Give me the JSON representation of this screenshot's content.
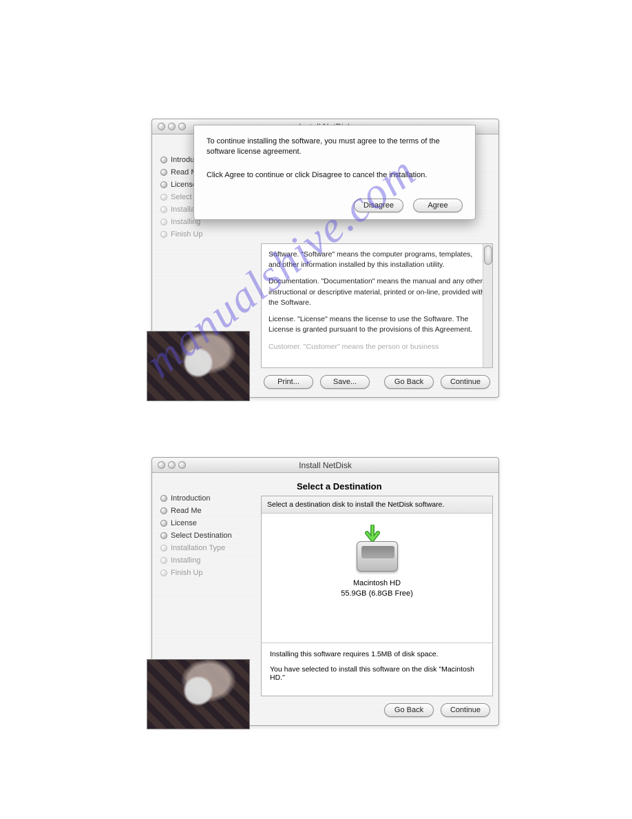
{
  "watermark": "manualshive.com",
  "window1": {
    "title": "Install NetDisk",
    "steps": [
      {
        "label": "Introduction",
        "dim": false
      },
      {
        "label": "Read Me",
        "dim": false
      },
      {
        "label": "License",
        "dim": false
      },
      {
        "label": "Select Destination",
        "dim": true
      },
      {
        "label": "Installation Type",
        "dim": true
      },
      {
        "label": "Installing",
        "dim": true
      },
      {
        "label": "Finish Up",
        "dim": true
      }
    ],
    "license": {
      "p1": "Software.  \"Software\" means the computer programs, templates, and other information installed by this installation utility.",
      "p2": "Documentation.  \"Documentation\" means the manual and any other instructional or descriptive material, printed or on-line, provided with the Software.",
      "p3": "License.  \"License\" means the license to use the Software. The License is granted pursuant to the provisions of this Agreement.",
      "p4": "Customer.  \"Customer\" means the person or business"
    },
    "buttons": {
      "print": "Print...",
      "save": "Save...",
      "go_back": "Go Back",
      "continue": "Continue"
    },
    "sheet": {
      "line1": "To continue installing the software, you must agree to the terms of the software license agreement.",
      "line2": "Click Agree to continue or click Disagree to cancel the installation.",
      "disagree": "Disagree",
      "agree": "Agree"
    }
  },
  "window2": {
    "title": "Install NetDisk",
    "heading": "Select a Destination",
    "subheading": "Select a destination disk to install the NetDisk software.",
    "steps": [
      {
        "label": "Introduction",
        "dim": false
      },
      {
        "label": "Read Me",
        "dim": false
      },
      {
        "label": "License",
        "dim": false
      },
      {
        "label": "Select Destination",
        "dim": false
      },
      {
        "label": "Installation Type",
        "dim": true
      },
      {
        "label": "Installing",
        "dim": true
      },
      {
        "label": "Finish Up",
        "dim": true
      }
    ],
    "disk": {
      "name": "Macintosh HD",
      "size": "55.9GB (6.8GB Free)"
    },
    "req": "Installing this software requires 1.5MB of disk space.",
    "sel": "You have selected to install this software on the disk \"Macintosh HD.\"",
    "buttons": {
      "go_back": "Go Back",
      "continue": "Continue"
    }
  }
}
